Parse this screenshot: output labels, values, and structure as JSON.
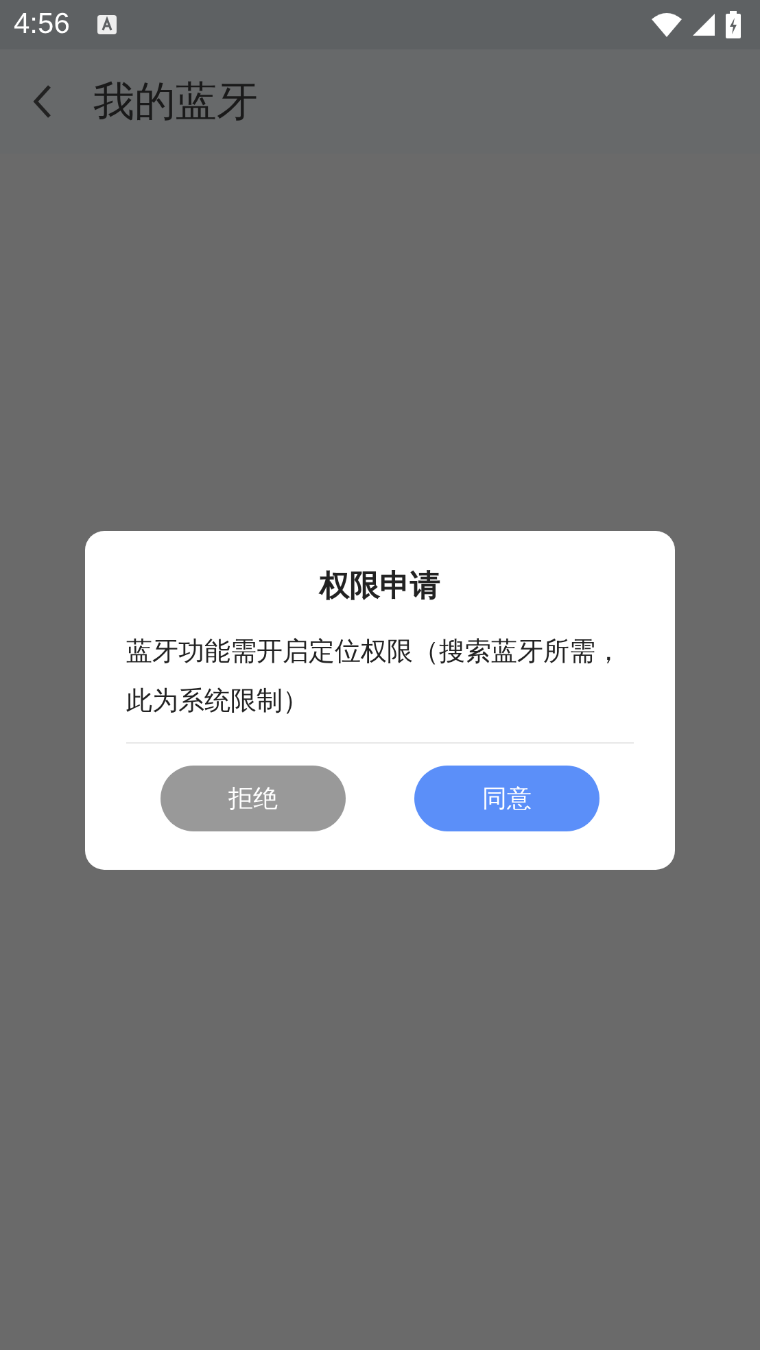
{
  "status_bar": {
    "time": "4:56"
  },
  "app_bar": {
    "title": "我的蓝牙"
  },
  "dialog": {
    "title": "权限申请",
    "message": "蓝牙功能需开启定位权限（搜索蓝牙所需，此为系统限制）",
    "buttons": [
      {
        "label": "拒绝",
        "kind": "secondary"
      },
      {
        "label": "同意",
        "kind": "primary"
      }
    ]
  }
}
